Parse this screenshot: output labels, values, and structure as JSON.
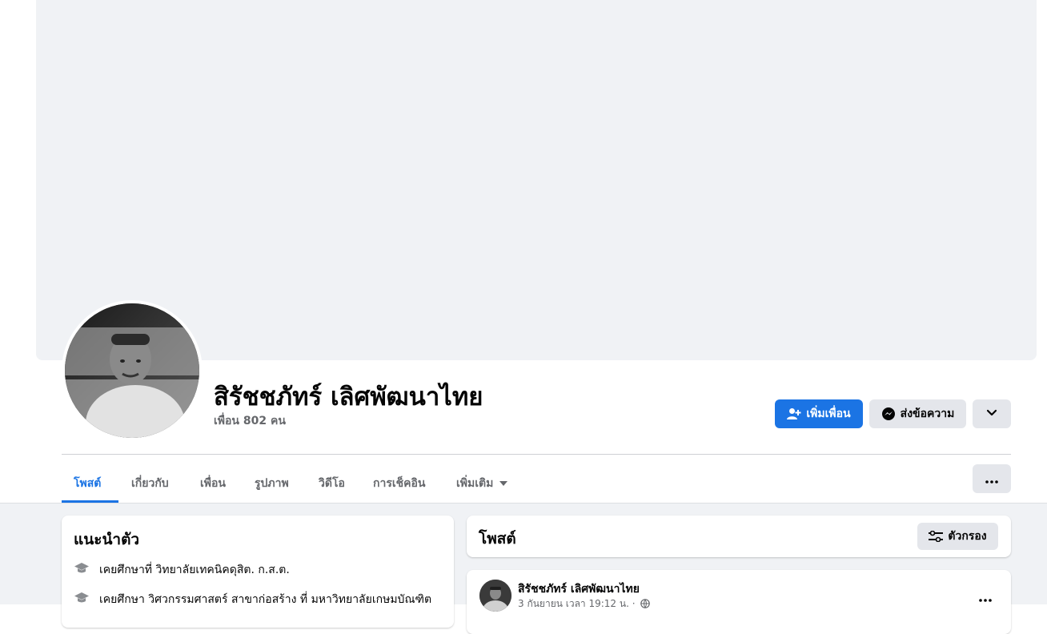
{
  "profile": {
    "name": "สิรัชชภัทร์ เลิศพัฒนาไทย",
    "friends_count": "เพื่อน 802 คน"
  },
  "actions": {
    "add_friend": "เพิ่มเพื่อน",
    "message": "ส่งข้อความ"
  },
  "tabs": [
    {
      "label": "โพสต์",
      "active": true
    },
    {
      "label": "เกี่ยวกับ",
      "active": false
    },
    {
      "label": "เพื่อน",
      "active": false
    },
    {
      "label": "รูปภาพ",
      "active": false
    },
    {
      "label": "วิดีโอ",
      "active": false
    },
    {
      "label": "การเช็คอิน",
      "active": false
    },
    {
      "label": "เพิ่มเติม",
      "active": false
    }
  ],
  "intro": {
    "title": "แนะนำตัว",
    "items": [
      {
        "icon": "graduation-cap-icon",
        "text": "เคยศึกษาที่ วิทยาลัยเทคนิคดุสิต. ก.ส.ต."
      },
      {
        "icon": "graduation-cap-icon",
        "text": "เคยศึกษา วิศวกรรมศาสตร์ สาขาก่อสร้าง ที่ มหาวิทยาลัยเกษมบัณฑิต"
      }
    ]
  },
  "posts": {
    "title": "โพสต์",
    "filter_label": "ตัวกรอง"
  },
  "post": {
    "author": "สิรัชชภัทร์ เลิศพัฒนาไทย",
    "meta": "3 กันยายน เวลา 19:12 น. ·"
  },
  "colors": {
    "accent": "#1b74e4",
    "secondary_button": "#e4e6eb",
    "background": "#f0f2f5",
    "muted_text": "#65676b"
  }
}
